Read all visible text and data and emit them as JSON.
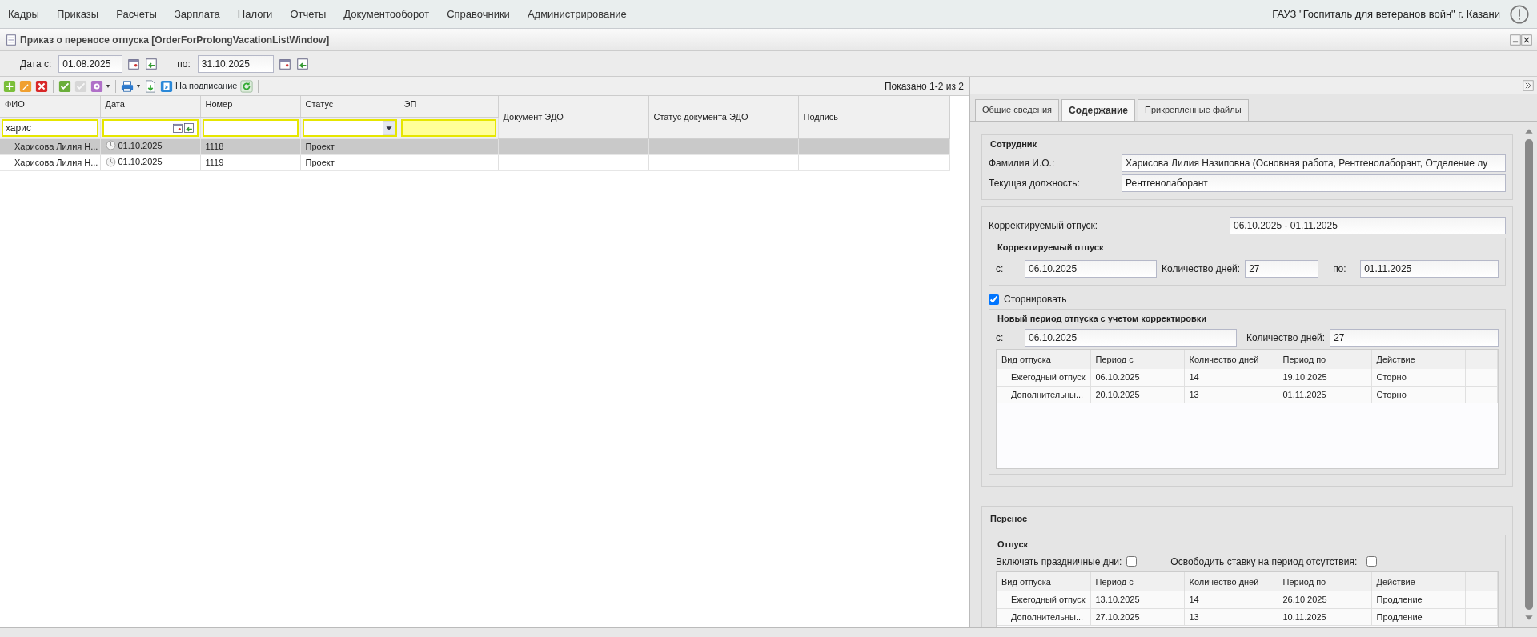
{
  "menu": [
    "Кадры",
    "Приказы",
    "Расчеты",
    "Зарплата",
    "Налоги",
    "Отчеты",
    "Документооборот",
    "Справочники",
    "Администрирование"
  ],
  "organization": "ГАУЗ \"Госпиталь для ветеранов войн\" г. Казани",
  "window": {
    "title": "Приказ о переносе отпуска [OrderForProlongVacationListWindow]"
  },
  "date_filter": {
    "from_label": "Дата с:",
    "from": "01.08.2025",
    "to_label": "по:",
    "to": "31.10.2025"
  },
  "toolbar": {
    "buttons": [
      {
        "kind": "add"
      },
      {
        "kind": "edit"
      },
      {
        "kind": "delete"
      },
      {
        "kind": "separator"
      },
      {
        "kind": "approve",
        "disabled": false
      },
      {
        "kind": "unapprove",
        "disabled": true
      },
      {
        "kind": "settings"
      },
      {
        "kind": "separator"
      },
      {
        "kind": "print"
      },
      {
        "kind": "export"
      },
      {
        "kind": "send",
        "label": "На подписание"
      },
      {
        "kind": "refresh"
      },
      {
        "kind": "separator"
      }
    ],
    "shown": "Показано 1-2 из 2"
  },
  "grid": {
    "columns": [
      "ФИО",
      "Дата",
      "Номер",
      "Статус",
      "ЭП",
      "Документ ЭДО",
      "Статус документа ЭДО",
      "Подпись"
    ],
    "filters": [
      {
        "kind": "text",
        "value": "харис"
      },
      {
        "kind": "date"
      },
      {
        "kind": "text"
      },
      {
        "kind": "select"
      },
      {
        "kind": "highlight"
      }
    ],
    "rows": [
      {
        "selected": true,
        "cells": [
          "Харисова Лилия Н...",
          "01.10.2025",
          "1118",
          "Проект",
          "",
          "",
          "",
          ""
        ]
      },
      {
        "selected": false,
        "cells": [
          "Харисова Лилия Н...",
          "01.10.2025",
          "1119",
          "Проект",
          "",
          "",
          "",
          ""
        ]
      }
    ]
  },
  "detail": {
    "tabs": [
      {
        "label": "Общие сведения",
        "selected": false
      },
      {
        "label": "Содержание",
        "selected": true
      },
      {
        "label": "Прикрепленные файлы",
        "selected": false
      }
    ],
    "employee": {
      "title": "Сотрудник",
      "fields": [
        {
          "label": "Фамилия И.О.:",
          "value": "Харисова Лилия Назиповна (Основная работа, Рентгенолаборант, Отделение лу"
        },
        {
          "label": "Текущая должность:",
          "value": "Рентгенолаборант"
        }
      ]
    },
    "corrected": {
      "label": "Корректируемый отпуск:",
      "value": "06.10.2025 - 01.11.2025",
      "group_title": "Корректируемый отпуск",
      "from_label": "с:",
      "from": "06.10.2025",
      "days_label": "Количество дней:",
      "days": "27",
      "to_label": "по:",
      "to": "01.11.2025"
    },
    "storno": {
      "label": "Сторнировать",
      "checked": true
    },
    "new_period": {
      "title": "Новый период отпуска с учетом корректировки",
      "from_label": "с:",
      "from": "06.10.2025",
      "days_label": "Количество дней:",
      "days": "27",
      "columns": [
        "Вид отпуска",
        "Период с",
        "Количество дней",
        "Период по",
        "Действие"
      ],
      "rows": [
        [
          "Ежегодный отпуск",
          "06.10.2025",
          "14",
          "19.10.2025",
          "Сторно"
        ],
        [
          "Дополнительны...",
          "20.10.2025",
          "13",
          "01.11.2025",
          "Сторно"
        ]
      ]
    },
    "transfer": {
      "title": "Перенос",
      "group_title": "Отпуск",
      "holidays_label": "Включать праздничные дни:",
      "holidays": false,
      "free_rate_label": "Освободить ставку на период отсутствия:",
      "free_rate": false,
      "columns": [
        "Вид отпуска",
        "Период с",
        "Количество дней",
        "Период по",
        "Действие"
      ],
      "rows": [
        [
          "Ежегодный отпуск",
          "13.10.2025",
          "14",
          "26.10.2025",
          "Продление"
        ],
        [
          "Дополнительны...",
          "27.10.2025",
          "13",
          "10.11.2025",
          "Продление"
        ]
      ]
    }
  }
}
